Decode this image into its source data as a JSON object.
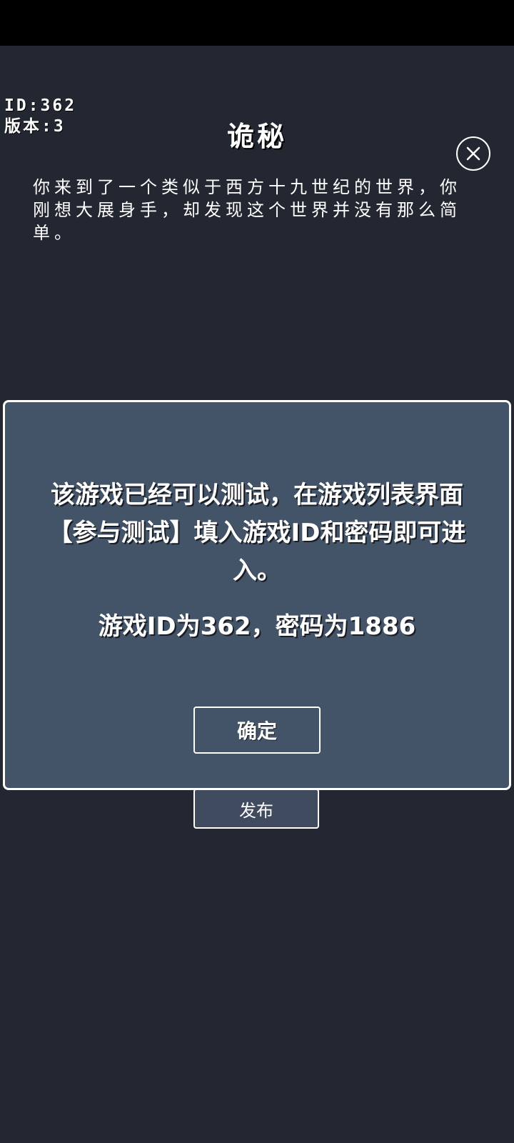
{
  "game": {
    "id_label": "ID:362",
    "version_label": "版本:3",
    "title": "诡秘",
    "description": "你来到了一个类似于西方十九世纪的世界，你刚想大展身手，却发现这个世界并没有那么简单。"
  },
  "close_button": {
    "icon": "close-icon"
  },
  "publish_button": {
    "label": "发布"
  },
  "dialog": {
    "message": "该游戏已经可以测试，在游戏列表界面【参与测试】填入游戏ID和密码即可进入。",
    "credentials": "游戏ID为362，密码为1886",
    "confirm_label": "确定"
  },
  "colors": {
    "background": "#232732",
    "dialog_background": "#435368",
    "button_background": "#404b60",
    "border": "#ffffff"
  }
}
